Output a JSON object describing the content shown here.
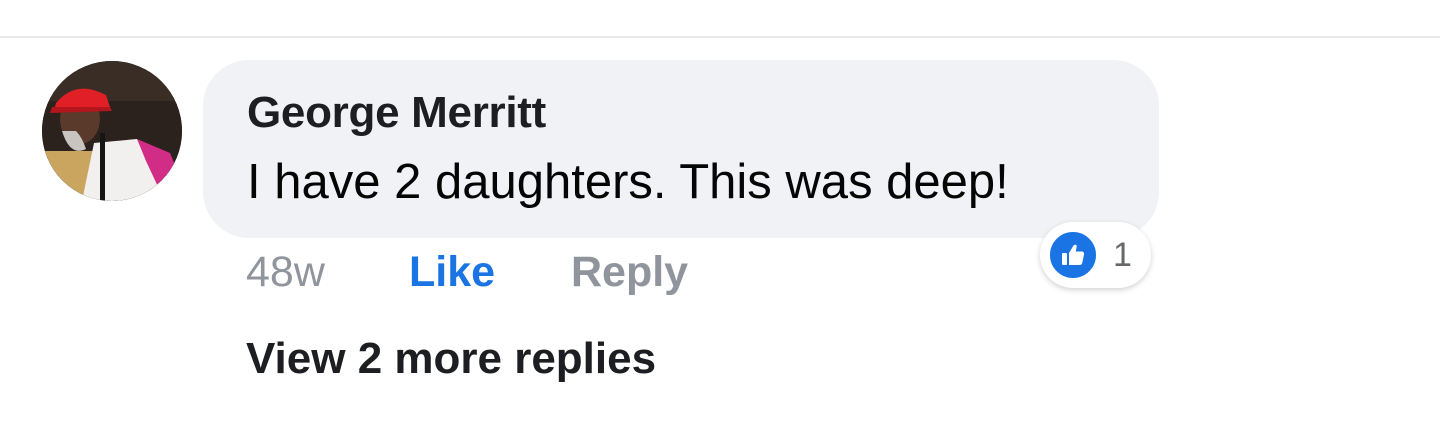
{
  "comment": {
    "author": "George Merritt",
    "text": "I have 2 daughters. This was deep!",
    "time": "48w",
    "like_label": "Like",
    "reply_label": "Reply",
    "reactions": {
      "icon": "thumbs-up-icon",
      "count": "1",
      "color": "#1b74e4"
    },
    "view_more_label": "View 2 more replies"
  },
  "colors": {
    "bubble_bg": "#f0f2f5",
    "accent": "#1b74e4",
    "secondary_text": "#90949c",
    "primary_text": "#1c1e21"
  }
}
